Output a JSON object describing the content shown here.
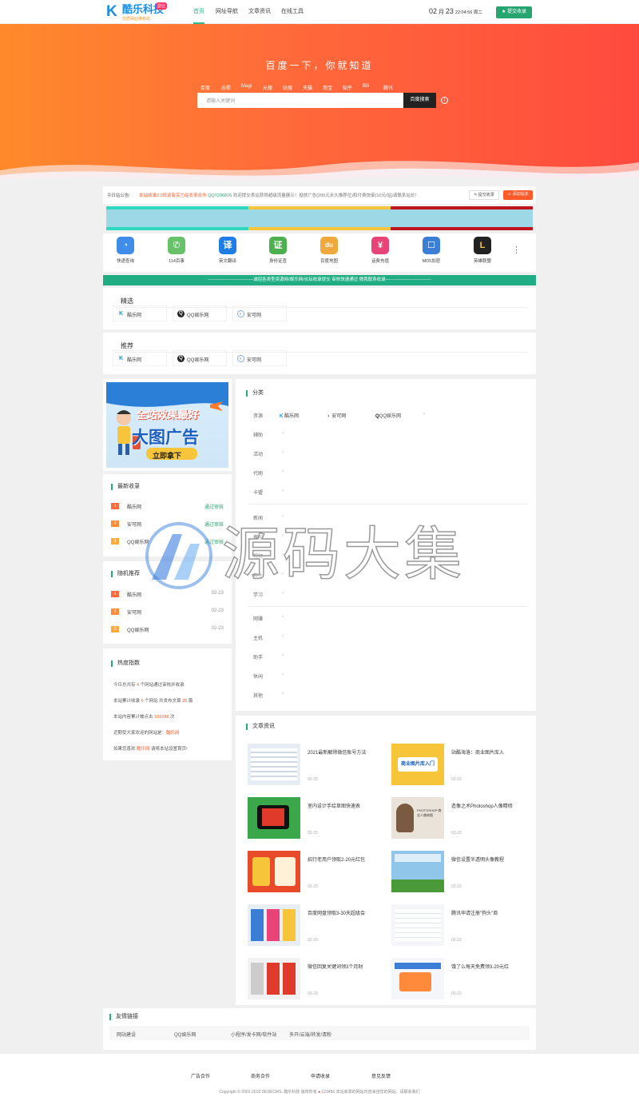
{
  "header": {
    "logo": {
      "name": "酷乐科技",
      "badge": "副业",
      "slogan": "优质网站推荐站"
    },
    "nav": [
      {
        "label": "首页"
      },
      {
        "label": "网址导航"
      },
      {
        "label": "文章资讯"
      },
      {
        "label": "在线工具"
      }
    ],
    "date": {
      "month": "02",
      "month_unit": "月",
      "day": "23",
      "time": "22:04:56 周二"
    },
    "submit_label": "提交收录"
  },
  "hero": {
    "slogan": "百度一下，你就知道",
    "tabs": [
      "百度",
      "谷歌",
      "Magi",
      "元搜",
      "站搜",
      "天猫",
      "淘宝",
      "知乎",
      "Bili",
      "腾讯"
    ],
    "search_placeholder": "请输入关键词",
    "search_button": "百度搜索",
    "help": "i"
  },
  "notice": {
    "label": "今日站公告:",
    "text_highlight": "本站收录2.0欢迎有实力站长来合作",
    "qq": "QQ7206876",
    "text": "欢迎提交表站获得超级流量展示！投放广告(200元永久推荐位)和付费快审(10元/站)请联系站长！",
    "submit_btn": "提交收录",
    "contact_btn": "添加站长"
  },
  "apps": [
    {
      "label": "快递查询",
      "icon": "delivery-icon",
      "color": "#3f8de8",
      "glyph": "◔"
    },
    {
      "label": "114百事",
      "icon": "phone-icon",
      "color": "#68c26a",
      "glyph": "✆"
    },
    {
      "label": "英文翻译",
      "icon": "translate-icon",
      "color": "#1f7ee6",
      "glyph": "译"
    },
    {
      "label": "身份证查",
      "icon": "idcard-icon",
      "color": "#4cb04f",
      "glyph": "证"
    },
    {
      "label": "百度地图",
      "icon": "map-icon",
      "color": "#f0a93c",
      "glyph": "du"
    },
    {
      "label": "话费充值",
      "icon": "recharge-icon",
      "color": "#e8447a",
      "glyph": "¥"
    },
    {
      "label": "MD5加密",
      "icon": "lock-icon",
      "color": "#3b7ed6",
      "glyph": "☐"
    },
    {
      "label": "英雄联盟",
      "icon": "game-icon",
      "color": "#222222",
      "glyph": "L"
    }
  ],
  "greenbar": "-------------------------------诚招各类型资源网/娱乐网/论坛收录提交 审核快速通过 微我联系收录-------------------------------",
  "featured": {
    "title": "精选",
    "sites": [
      "酷乐网",
      "QQ娱乐网",
      "安可网"
    ]
  },
  "recommend": {
    "title": "推荐",
    "sites": [
      "酷乐网",
      "QQ娱乐网",
      "安可网"
    ]
  },
  "ad": {
    "line1": "全站效果最好",
    "line2": "大图广告",
    "cta": "立即拿下"
  },
  "latest": {
    "title": "最新收录",
    "items": [
      {
        "rank": "1",
        "name": "酷乐网",
        "status": "通过审核"
      },
      {
        "rank": "2",
        "name": "安可网",
        "status": "通过审核"
      },
      {
        "rank": "3",
        "name": "QQ娱乐网",
        "status": "通过审核"
      }
    ]
  },
  "random": {
    "title": "随机推荐",
    "items": [
      {
        "rank": "1",
        "name": "酷乐网",
        "date": "02-23"
      },
      {
        "rank": "2",
        "name": "安可网",
        "date": "02-23"
      },
      {
        "rank": "3",
        "name": "QQ娱乐网",
        "date": "02-23"
      }
    ]
  },
  "hot": {
    "title": "热度指数",
    "lines": [
      {
        "pre": "今日总共有 ",
        "val": "4",
        "post": " 个网站通过审核并收录"
      },
      {
        "pre": "本站累计收录 ",
        "val": "6",
        "post": " 个网站  共发布文章 ",
        "val2": "26",
        "post2": " 篇"
      },
      {
        "pre": "本站内容累计被点击 ",
        "val": "103248",
        "post": " 次"
      },
      {
        "pre": "近期受大家欢迎的网站是：",
        "val": "酷乐网",
        "post": ""
      },
      {
        "pre": "如果您喜欢 ",
        "val": "酷乐网",
        "post": " 请将本站设置首页!"
      }
    ]
  },
  "categories": {
    "title": "分类",
    "items": [
      {
        "label": "资源",
        "sites": [
          "酷乐网",
          "安可网",
          "QQ娱乐网"
        ]
      },
      {
        "label": "辅助"
      },
      {
        "label": "活动"
      },
      {
        "label": "代刷"
      },
      {
        "label": "卡盟"
      },
      {
        "label": "新闻"
      },
      {
        "label": "搜索"
      },
      {
        "label": "视频"
      },
      {
        "label": "软件"
      },
      {
        "label": "学习"
      },
      {
        "label": "网赚"
      },
      {
        "label": "主机"
      },
      {
        "label": "助手"
      },
      {
        "label": "休闲"
      },
      {
        "label": "其他"
      }
    ]
  },
  "articles": {
    "title": "文章资讯",
    "items": [
      {
        "title": "2021最新解除微信账号方法",
        "date": "02-23"
      },
      {
        "title": "站酷海洛：商业图片库入",
        "date": "02-23"
      },
      {
        "title": "室内设计手绘草图快速表",
        "date": "02-23"
      },
      {
        "title": "造像之术Photoshop人像精修",
        "date": "02-23"
      },
      {
        "title": "招行老用户领取2-20元红包",
        "date": "02-23"
      },
      {
        "title": "微信设置半透明头像教程",
        "date": "02-23"
      },
      {
        "title": "百度网盘领取3-30天超级会",
        "date": "02-23"
      },
      {
        "title": "腾讯申请注册\"狗头\"商",
        "date": "02-23"
      },
      {
        "title": "微信回复关键词领3个月财",
        "date": "02-23"
      },
      {
        "title": "饿了么每天免费领3-20元红",
        "date": "02-23"
      }
    ],
    "thumb_texts": [
      "商业图片库入门",
      "PHOTOSHOP 商业人像修图"
    ]
  },
  "links": {
    "title": "友情链接",
    "items": [
      "网站建设",
      "QQ娱乐网",
      "小程序/发卡网/软件站",
      "多开/云端/转发/清粉"
    ]
  },
  "footer": {
    "items": [
      "广告合作",
      "商务合作",
      "申请收录",
      "意见反馈"
    ],
    "copyright": "Copyright © 2002-2019 DEDECMS. 酷乐科技 版权所有",
    "icp": "123456",
    "disclaimer": "本站收录的网站内容来自您的网站，请联系我们"
  },
  "watermark": "源码大集",
  "colors": {
    "accent": "#21ad83",
    "hero_start": "#ff8a2b",
    "hero_end": "#ff4a3e",
    "highlight": "#ff5a2a"
  }
}
